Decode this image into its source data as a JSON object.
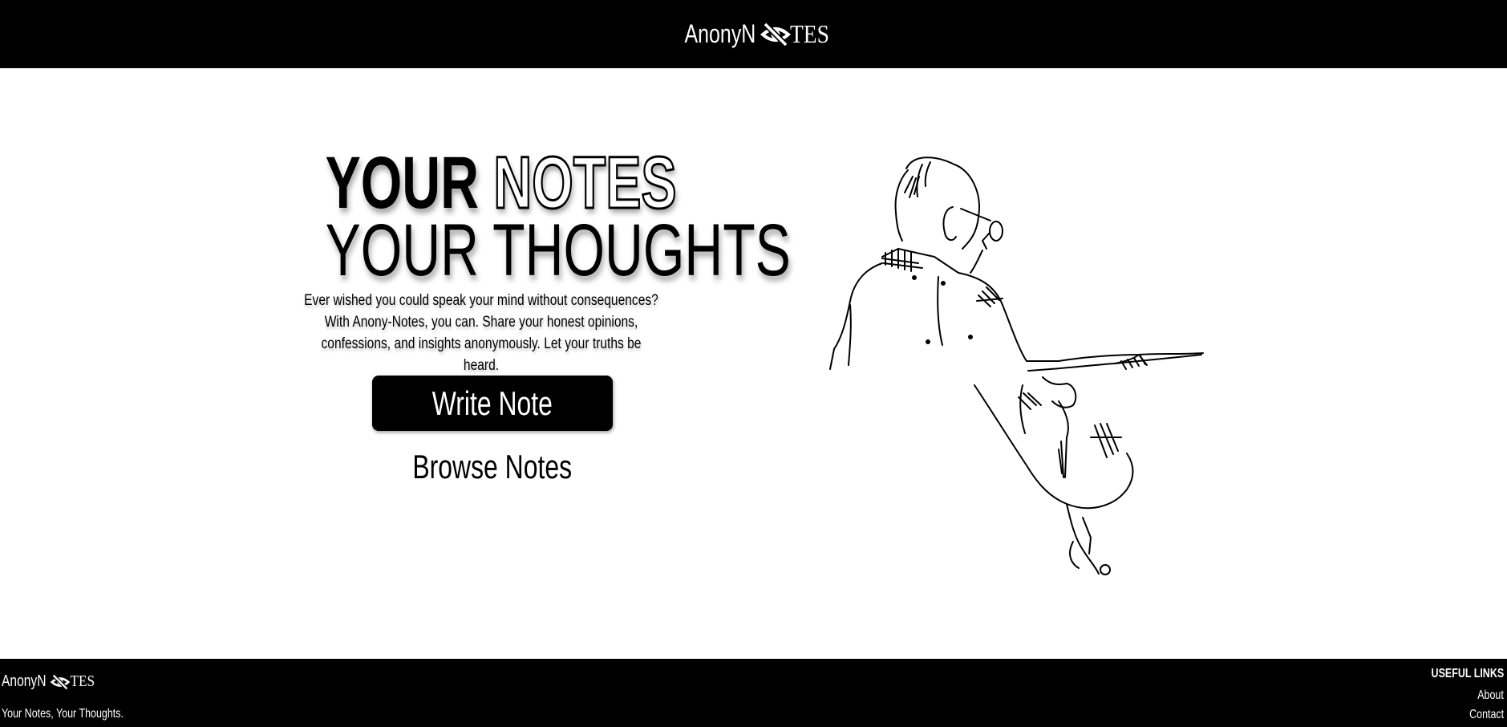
{
  "header": {
    "logo_prefix": "AnonyN",
    "logo_icon": "eye-slash-icon",
    "logo_suffix": "TES"
  },
  "hero": {
    "title_solid": "YOUR",
    "title_outline": "NOTES",
    "title_line2": "YOUR THOUGHTS",
    "description": "Ever wished you could speak your mind without consequences? With Anony-Notes, you can. Share your honest opinions, confessions, and insights anonymously. Let your truths be heard.",
    "write_button": "Write Note",
    "browse_link": "Browse Notes",
    "illustration": "ink-sketch-man-reading-icon"
  },
  "footer": {
    "logo_prefix": "AnonyN",
    "logo_icon": "eye-slash-icon",
    "logo_suffix": "TES",
    "tagline": "Your Notes, Your Thoughts.",
    "links_title": "USEFUL LINKS",
    "links": [
      "About",
      "Contact"
    ]
  },
  "colors": {
    "bar_background": "#000000",
    "page_background": "#ffffff",
    "text": "#000000"
  }
}
